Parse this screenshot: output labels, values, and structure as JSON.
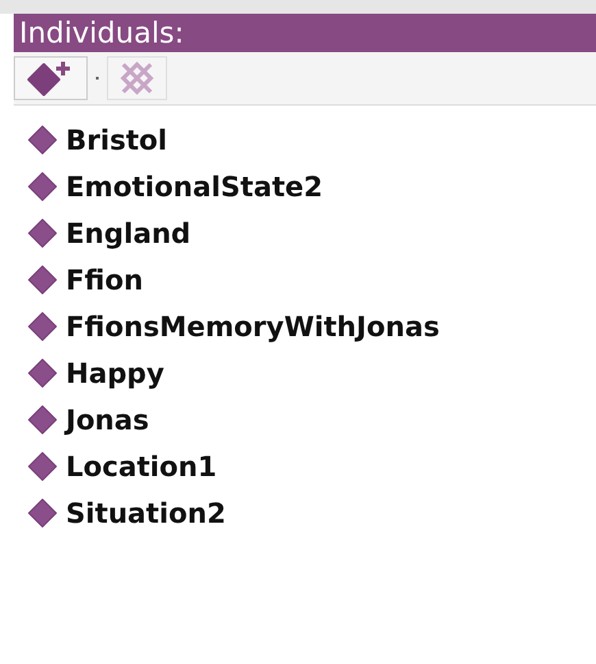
{
  "panel": {
    "title": "Individuals:"
  },
  "toolbar": [
    {
      "kind": "add",
      "disabled": false
    },
    {
      "kind": "delete",
      "disabled": true
    }
  ],
  "individuals": [
    {
      "label": "Bristol"
    },
    {
      "label": "EmotionalState2"
    },
    {
      "label": "England"
    },
    {
      "label": "Ffion"
    },
    {
      "label": "FfionsMemoryWithJonas"
    },
    {
      "label": "Happy"
    },
    {
      "label": "Jonas"
    },
    {
      "label": "Location1"
    },
    {
      "label": "Situation2"
    }
  ]
}
